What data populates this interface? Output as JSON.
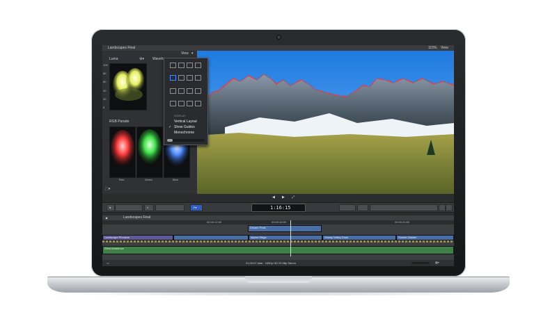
{
  "app": {
    "project_title": "Landscapes Final",
    "zoom_level": "115%",
    "view_menu_label": "View",
    "viewer_view_label": "View"
  },
  "scopes": {
    "luma_label": "Luma",
    "waveform_label": "Waveform",
    "rgb_parade_label": "RGB Parade",
    "scale_ticks": [
      "100",
      "80",
      "60",
      "40",
      "20",
      "0"
    ],
    "parade_labels": [
      "Red",
      "Green",
      "Blue"
    ]
  },
  "popup": {
    "section_label": "DISPLAY",
    "items": [
      {
        "label": "Vertical Layout",
        "checked": false
      },
      {
        "label": "Show Guides",
        "checked": true
      },
      {
        "label": "Monochrome",
        "checked": false
      }
    ]
  },
  "toolbar": {
    "timecode": "1:16:15"
  },
  "timeline": {
    "index_title": "Landscapes Final",
    "ruler_marks": [
      "00:00:12:00",
      "00:00:16:00",
      "00:00:20:00"
    ],
    "clips_upper": [
      "Distant Peak"
    ],
    "clips_primary": [
      "Landscape Pinnacle",
      "Alpine Ridge",
      "Snowy Valley Dusk",
      "Sunset Glacier"
    ],
    "audio_label": "Wind Ambience",
    "status": "01:00:07 total · 1080p HD 23.98p Stereo"
  },
  "colors": {
    "accent_blue": "#3a6fd8",
    "waveform_red": "#ff2a2a",
    "clip_blue": "#4a6ea8",
    "clip_purple": "#6a5ea0",
    "audio_green": "#3f7f4a"
  }
}
